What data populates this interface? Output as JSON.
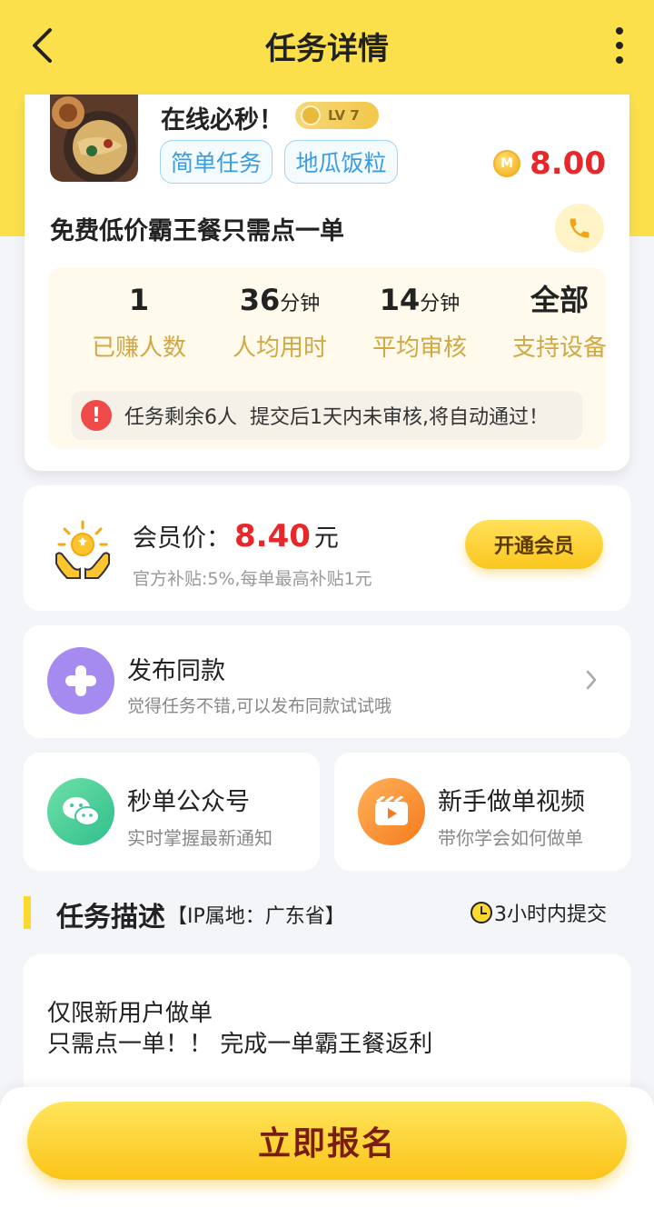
{
  "header": {
    "title": "任务详情"
  },
  "task": {
    "shop_name": "在线必秒！",
    "level": "LV 7",
    "tags": [
      "简单任务",
      "地瓜饭粒"
    ],
    "coin_symbol": "M",
    "price": "8.00",
    "title": "免费低价霸王餐只需点一单",
    "stats": [
      {
        "value": "1",
        "unit": "",
        "label": "已赚人数"
      },
      {
        "value": "36",
        "unit": "分钟",
        "label": "人均用时"
      },
      {
        "value": "14",
        "unit": "分钟",
        "label": "平均审核"
      },
      {
        "value": "全部",
        "unit": "",
        "label": "支持设备"
      }
    ],
    "notice": "任务剩余6人  提交后1天内未审核,将自动通过！"
  },
  "vip": {
    "label": "会员价：",
    "price": "8.40",
    "unit": "元",
    "sub": "官方补贴:5%,每单最高补贴1元",
    "button": "开通会员"
  },
  "publish": {
    "title": "发布同款",
    "sub": "觉得任务不错,可以发布同款试试哦"
  },
  "wechat": {
    "title": "秒单公众号",
    "sub": "实时掌握最新通知"
  },
  "video": {
    "title": "新手做单视频",
    "sub": "带你学会如何做单"
  },
  "description": {
    "title": "任务描述",
    "ip": "【IP属地：广东省】",
    "time": "3小时内提交",
    "lines": [
      "仅限新用户做单",
      "只需点一单！！ 完成一单霸王餐返利"
    ]
  },
  "footer": {
    "button": "立即报名"
  },
  "colors": {
    "brand_yellow": "#fbe04c",
    "price_red": "#e8272a",
    "tag_blue": "#3a9be0",
    "stat_label": "#d1a843"
  }
}
